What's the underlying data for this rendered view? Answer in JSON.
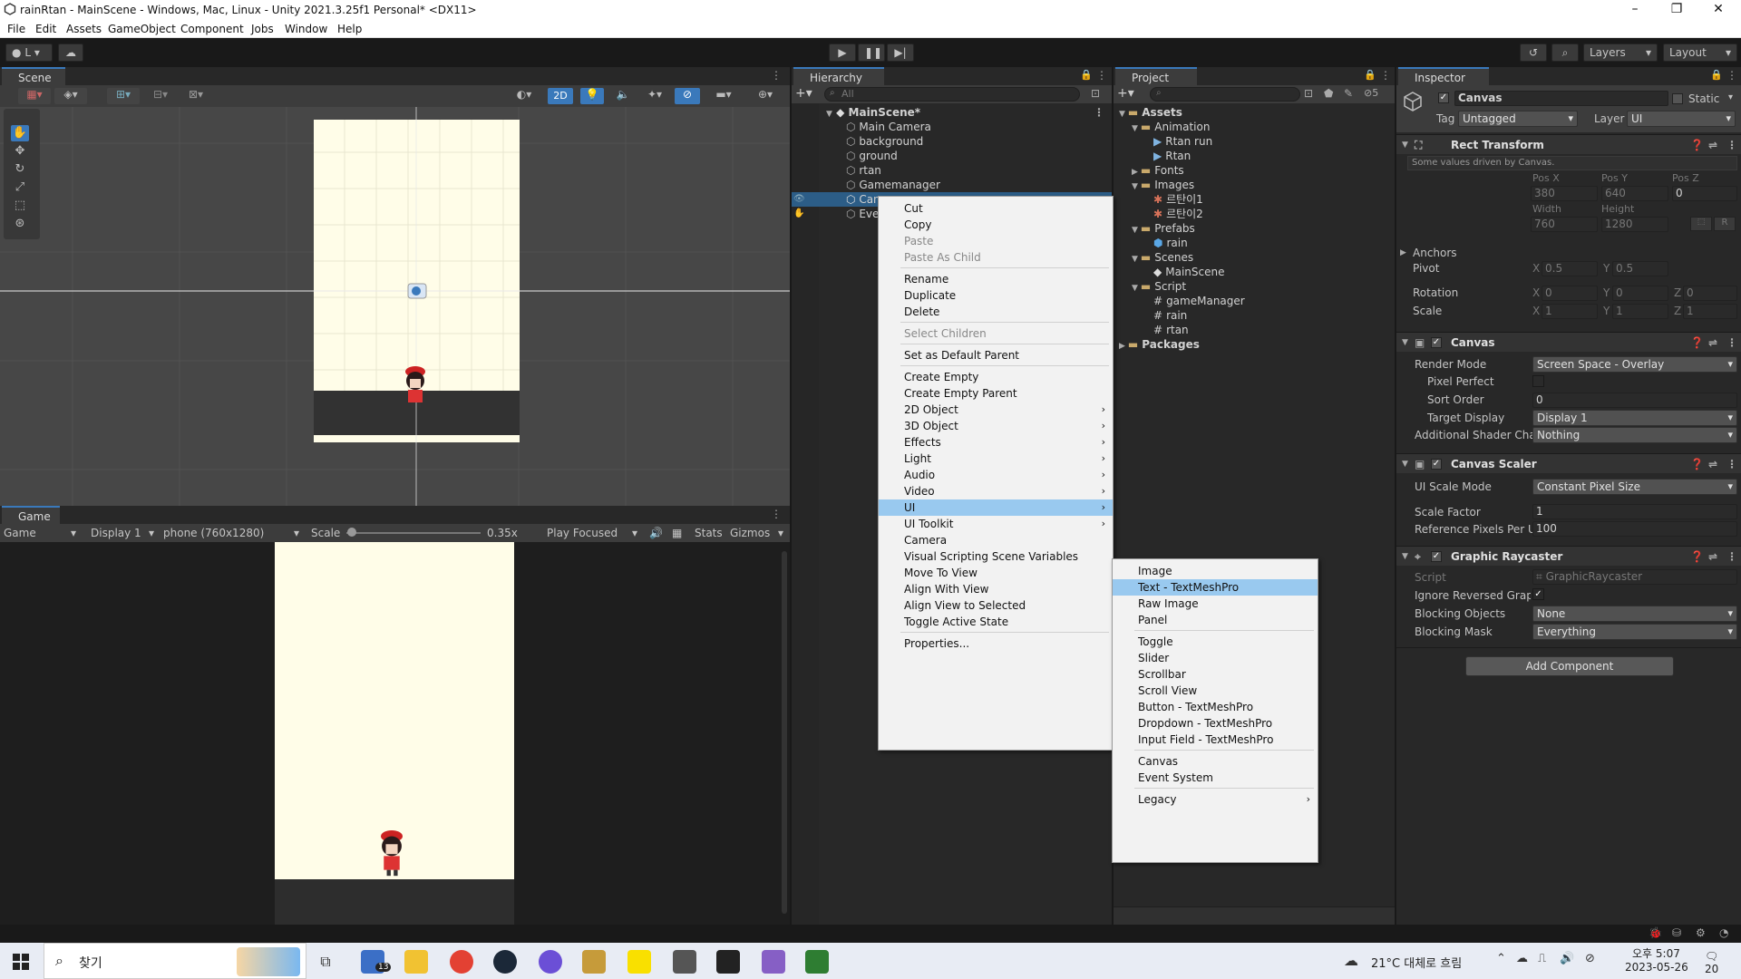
{
  "window": {
    "title": "rainRtan - MainScene - Windows, Mac, Linux - Unity 2021.3.25f1 Personal* <DX11>"
  },
  "menu": [
    "File",
    "Edit",
    "Assets",
    "GameObject",
    "Component",
    "Jobs",
    "Window",
    "Help"
  ],
  "toolbar": {
    "account": "L",
    "layers": "Layers",
    "layout": "Layout"
  },
  "scene": {
    "tab": "Scene",
    "mode2d": "2D"
  },
  "game": {
    "tab": "Game",
    "view": "Game",
    "display": "Display 1",
    "resolution": "phone (760x1280)",
    "scale_label": "Scale",
    "scale_value": "0.35x",
    "play_focused": "Play Focused",
    "stats": "Stats",
    "gizmos": "Gizmos"
  },
  "hierarchy": {
    "tab": "Hierarchy",
    "search_placeholder": "All",
    "scene": "MainScene*",
    "items": [
      "Main Camera",
      "background",
      "ground",
      "rtan",
      "Gamemanager",
      "Canvas",
      "EventSystem"
    ]
  },
  "project": {
    "tab": "Project",
    "badge": "5",
    "tree": [
      {
        "label": "Assets",
        "depth": 0,
        "type": "folder",
        "open": true
      },
      {
        "label": "Animation",
        "depth": 1,
        "type": "folder",
        "open": true
      },
      {
        "label": "Rtan run",
        "depth": 2,
        "type": "anim"
      },
      {
        "label": "Rtan",
        "depth": 2,
        "type": "anim"
      },
      {
        "label": "Fonts",
        "depth": 1,
        "type": "folder",
        "open": false
      },
      {
        "label": "Images",
        "depth": 1,
        "type": "folder",
        "open": true
      },
      {
        "label": "르탄이1",
        "depth": 2,
        "type": "sprite"
      },
      {
        "label": "르탄이2",
        "depth": 2,
        "type": "sprite"
      },
      {
        "label": "Prefabs",
        "depth": 1,
        "type": "folder",
        "open": true
      },
      {
        "label": "rain",
        "depth": 2,
        "type": "prefab"
      },
      {
        "label": "Scenes",
        "depth": 1,
        "type": "folder",
        "open": true
      },
      {
        "label": "MainScene",
        "depth": 2,
        "type": "scene"
      },
      {
        "label": "Script",
        "depth": 1,
        "type": "folder",
        "open": true
      },
      {
        "label": "gameManager",
        "depth": 2,
        "type": "script"
      },
      {
        "label": "rain",
        "depth": 2,
        "type": "script"
      },
      {
        "label": "rtan",
        "depth": 2,
        "type": "script"
      },
      {
        "label": "Packages",
        "depth": 0,
        "type": "folder",
        "open": false
      }
    ]
  },
  "inspector": {
    "tab": "Inspector",
    "object_name": "Canvas",
    "static": "Static",
    "tag_label": "Tag",
    "tag": "Untagged",
    "layer_label": "Layer",
    "layer": "UI",
    "rect": {
      "title": "Rect Transform",
      "note": "Some values driven by Canvas.",
      "posx_l": "Pos X",
      "posy_l": "Pos Y",
      "posz_l": "Pos Z",
      "posx": "380",
      "posy": "640",
      "posz": "0",
      "width_l": "Width",
      "height_l": "Height",
      "width": "760",
      "height": "1280",
      "anchors": "Anchors",
      "pivot": "Pivot",
      "pivot_x": "0.5",
      "pivot_y": "0.5",
      "rotation": "Rotation",
      "rot_x": "0",
      "rot_y": "0",
      "rot_z": "0",
      "scale": "Scale",
      "scale_x": "1",
      "scale_y": "1",
      "scale_z": "1",
      "x": "X",
      "y": "Y",
      "z": "Z",
      "r": "R"
    },
    "canvas": {
      "title": "Canvas",
      "render_mode_l": "Render Mode",
      "render_mode": "Screen Space - Overlay",
      "pixel_perfect_l": "Pixel Perfect",
      "sort_order_l": "Sort Order",
      "sort_order": "0",
      "target_display_l": "Target Display",
      "target_display": "Display 1",
      "shader_l": "Additional Shader Char",
      "shader": "Nothing"
    },
    "scaler": {
      "title": "Canvas Scaler",
      "mode_l": "UI Scale Mode",
      "mode": "Constant Pixel Size",
      "factor_l": "Scale Factor",
      "factor": "1",
      "ppu_l": "Reference Pixels Per Ui",
      "ppu": "100"
    },
    "raycaster": {
      "title": "Graphic Raycaster",
      "script_l": "Script",
      "script": "GraphicRaycaster",
      "ignore_l": "Ignore Reversed Graphi",
      "blocking_l": "Blocking Objects",
      "blocking": "None",
      "mask_l": "Blocking Mask",
      "mask": "Everything"
    },
    "add_component": "Add Component"
  },
  "context_menu": {
    "items": [
      {
        "label": "Cut"
      },
      {
        "label": "Copy"
      },
      {
        "label": "Paste",
        "disabled": true
      },
      {
        "label": "Paste As Child",
        "disabled": true
      },
      {
        "sep": true
      },
      {
        "label": "Rename"
      },
      {
        "label": "Duplicate"
      },
      {
        "label": "Delete"
      },
      {
        "sep": true
      },
      {
        "label": "Select Children",
        "disabled": true
      },
      {
        "sep": true
      },
      {
        "label": "Set as Default Parent"
      },
      {
        "sep": true
      },
      {
        "label": "Create Empty"
      },
      {
        "label": "Create Empty Parent"
      },
      {
        "label": "2D Object",
        "sub": true
      },
      {
        "label": "3D Object",
        "sub": true
      },
      {
        "label": "Effects",
        "sub": true
      },
      {
        "label": "Light",
        "sub": true
      },
      {
        "label": "Audio",
        "sub": true
      },
      {
        "label": "Video",
        "sub": true
      },
      {
        "label": "UI",
        "sub": true,
        "active": true
      },
      {
        "label": "UI Toolkit",
        "sub": true
      },
      {
        "label": "Camera"
      },
      {
        "label": "Visual Scripting Scene Variables"
      },
      {
        "label": "Move To View"
      },
      {
        "label": "Align With View"
      },
      {
        "label": "Align View to Selected"
      },
      {
        "label": "Toggle Active State"
      },
      {
        "sep": true
      },
      {
        "label": "Properties..."
      }
    ]
  },
  "ui_submenu": {
    "items": [
      {
        "label": "Image"
      },
      {
        "label": "Text - TextMeshPro",
        "active": true
      },
      {
        "label": "Raw Image"
      },
      {
        "label": "Panel"
      },
      {
        "sep": true
      },
      {
        "label": "Toggle"
      },
      {
        "label": "Slider"
      },
      {
        "label": "Scrollbar"
      },
      {
        "label": "Scroll View"
      },
      {
        "label": "Button - TextMeshPro"
      },
      {
        "label": "Dropdown - TextMeshPro"
      },
      {
        "label": "Input Field - TextMeshPro"
      },
      {
        "sep": true
      },
      {
        "label": "Canvas"
      },
      {
        "label": "Event System"
      },
      {
        "sep": true
      },
      {
        "label": "Legacy",
        "sub": true
      }
    ]
  },
  "taskbar": {
    "search": "찾기",
    "mail_badge": "13",
    "weather": "21°C 대체로 흐림",
    "time": "오후 5:07",
    "date": "2023-05-26",
    "notif": "20"
  }
}
